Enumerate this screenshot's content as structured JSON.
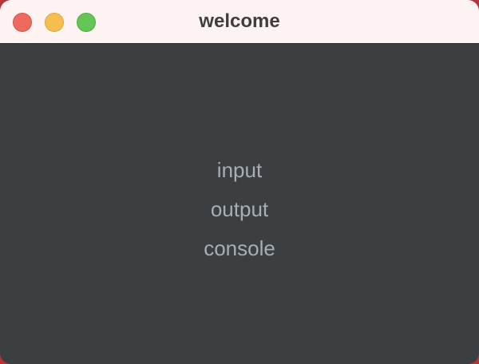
{
  "window": {
    "title": "welcome"
  },
  "menu": {
    "items": [
      {
        "label": "input"
      },
      {
        "label": "output"
      },
      {
        "label": "console"
      }
    ]
  },
  "colors": {
    "titlebar_bg": "#fdf3f2",
    "content_bg": "#3c3f41",
    "item_text": "#a9aeb3",
    "close": "#ee6a5f",
    "minimize": "#f5be4f",
    "zoom": "#62c554"
  }
}
